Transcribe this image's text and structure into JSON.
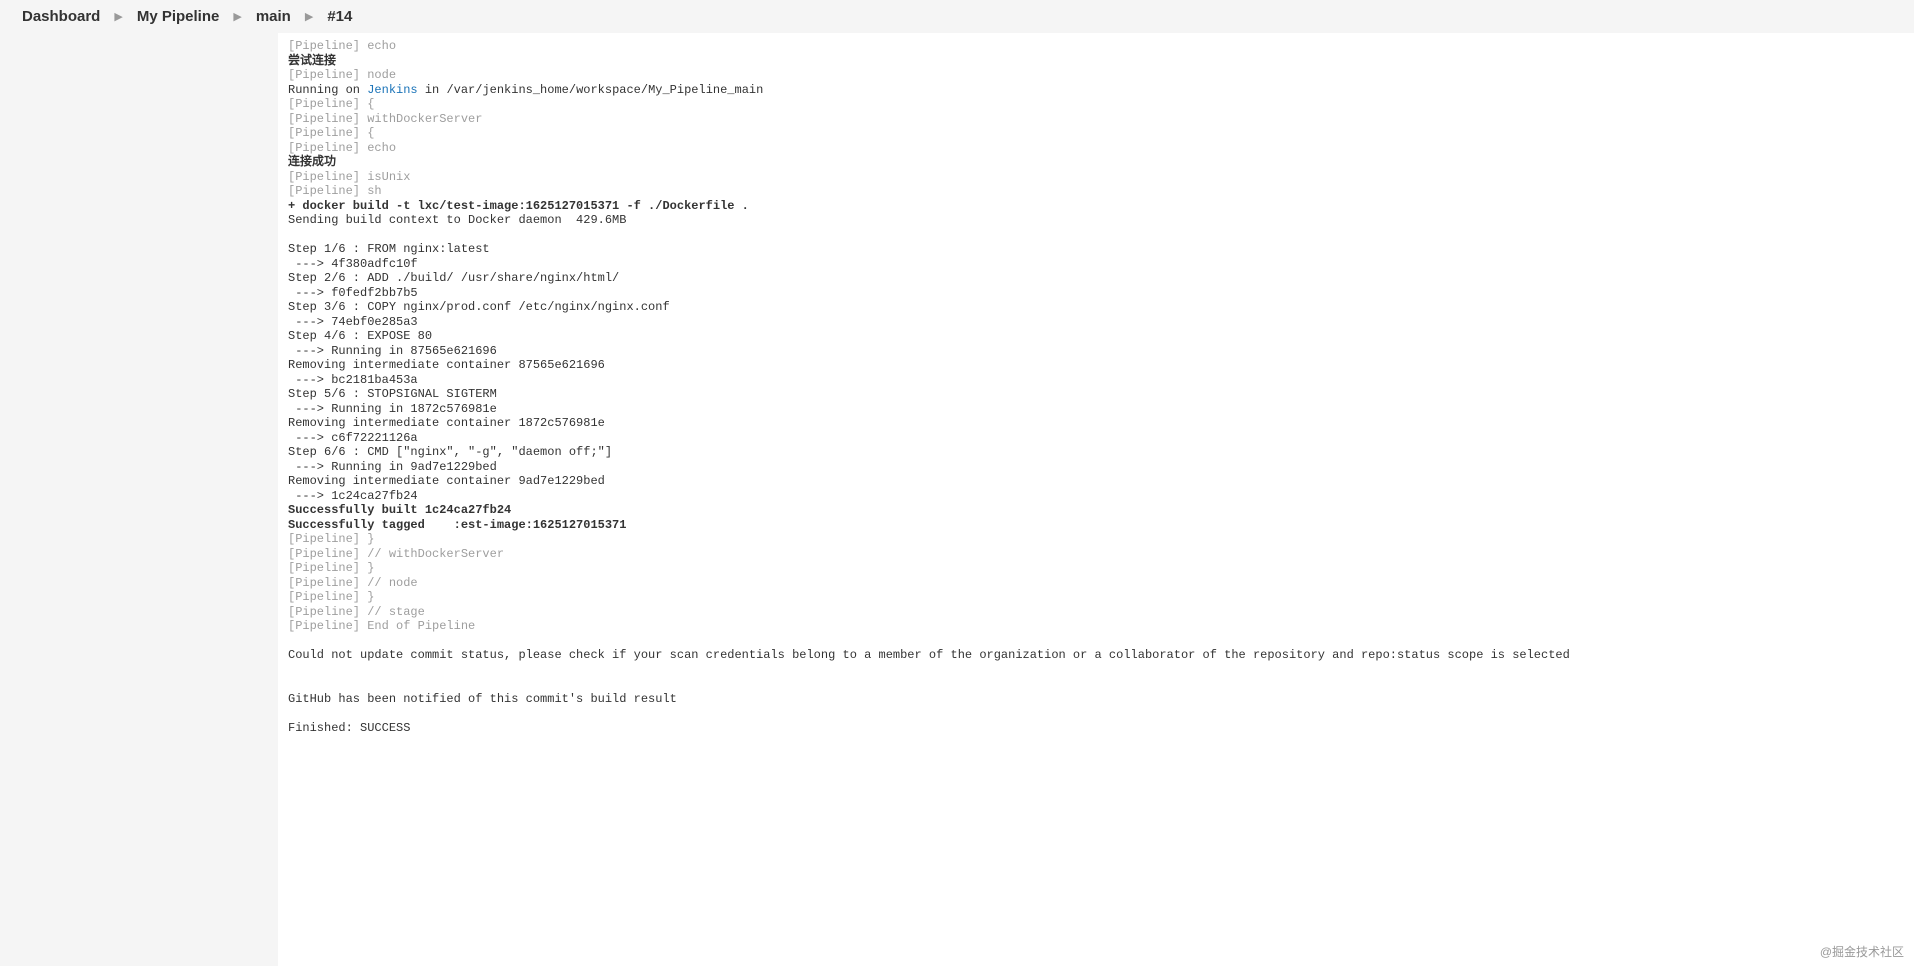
{
  "breadcrumb": {
    "items": [
      "Dashboard",
      "My Pipeline",
      "main",
      "#14"
    ]
  },
  "console": {
    "lines": [
      {
        "cls": "dim",
        "text": "[Pipeline] echo"
      },
      {
        "cls": "bold",
        "text": "尝试连接"
      },
      {
        "cls": "dim",
        "text": "[Pipeline] node"
      },
      {
        "cls": "",
        "segments": [
          {
            "cls": "",
            "text": "Running on "
          },
          {
            "cls": "link",
            "text": "Jenkins"
          },
          {
            "cls": "",
            "text": " in /var/jenkins_home/workspace/My_Pipeline_main"
          }
        ]
      },
      {
        "cls": "dim",
        "text": "[Pipeline] {"
      },
      {
        "cls": "dim",
        "text": "[Pipeline] withDockerServer"
      },
      {
        "cls": "dim",
        "text": "[Pipeline] {"
      },
      {
        "cls": "dim",
        "text": "[Pipeline] echo"
      },
      {
        "cls": "bold",
        "text": "连接成功"
      },
      {
        "cls": "dim",
        "text": "[Pipeline] isUnix"
      },
      {
        "cls": "dim",
        "text": "[Pipeline] sh"
      },
      {
        "cls": "bold",
        "text": "+ docker build -t lxc/test-image:1625127015371 -f ./Dockerfile ."
      },
      {
        "cls": "",
        "text": "Sending build context to Docker daemon  429.6MB"
      },
      {
        "cls": "",
        "text": ""
      },
      {
        "cls": "",
        "text": "Step 1/6 : FROM nginx:latest"
      },
      {
        "cls": "",
        "text": " ---> 4f380adfc10f"
      },
      {
        "cls": "",
        "text": "Step 2/6 : ADD ./build/ /usr/share/nginx/html/"
      },
      {
        "cls": "",
        "text": " ---> f0fedf2bb7b5"
      },
      {
        "cls": "",
        "text": "Step 3/6 : COPY nginx/prod.conf /etc/nginx/nginx.conf"
      },
      {
        "cls": "",
        "text": " ---> 74ebf0e285a3"
      },
      {
        "cls": "",
        "text": "Step 4/6 : EXPOSE 80"
      },
      {
        "cls": "",
        "text": " ---> Running in 87565e621696"
      },
      {
        "cls": "",
        "text": "Removing intermediate container 87565e621696"
      },
      {
        "cls": "",
        "text": " ---> bc2181ba453a"
      },
      {
        "cls": "",
        "text": "Step 5/6 : STOPSIGNAL SIGTERM"
      },
      {
        "cls": "",
        "text": " ---> Running in 1872c576981e"
      },
      {
        "cls": "",
        "text": "Removing intermediate container 1872c576981e"
      },
      {
        "cls": "",
        "text": " ---> c6f72221126a"
      },
      {
        "cls": "",
        "text": "Step 6/6 : CMD [\"nginx\", \"-g\", \"daemon off;\"]"
      },
      {
        "cls": "",
        "text": " ---> Running in 9ad7e1229bed"
      },
      {
        "cls": "",
        "text": "Removing intermediate container 9ad7e1229bed"
      },
      {
        "cls": "",
        "text": " ---> 1c24ca27fb24"
      },
      {
        "cls": "bold",
        "text": "Successfully built 1c24ca27fb24"
      },
      {
        "cls": "bold",
        "text": "Successfully tagged    :est-image:1625127015371"
      },
      {
        "cls": "dim",
        "text": "[Pipeline] }"
      },
      {
        "cls": "dim",
        "text": "[Pipeline] // withDockerServer"
      },
      {
        "cls": "dim",
        "text": "[Pipeline] }"
      },
      {
        "cls": "dim",
        "text": "[Pipeline] // node"
      },
      {
        "cls": "dim",
        "text": "[Pipeline] }"
      },
      {
        "cls": "dim",
        "text": "[Pipeline] // stage"
      },
      {
        "cls": "dim",
        "text": "[Pipeline] End of Pipeline"
      },
      {
        "cls": "",
        "text": ""
      },
      {
        "cls": "",
        "text": "Could not update commit status, please check if your scan credentials belong to a member of the organization or a collaborator of the repository and repo:status scope is selected"
      },
      {
        "cls": "",
        "text": ""
      },
      {
        "cls": "",
        "text": ""
      },
      {
        "cls": "",
        "text": "GitHub has been notified of this commit's build result"
      },
      {
        "cls": "",
        "text": ""
      },
      {
        "cls": "",
        "text": "Finished: SUCCESS"
      }
    ]
  },
  "watermark": "@掘金技术社区"
}
